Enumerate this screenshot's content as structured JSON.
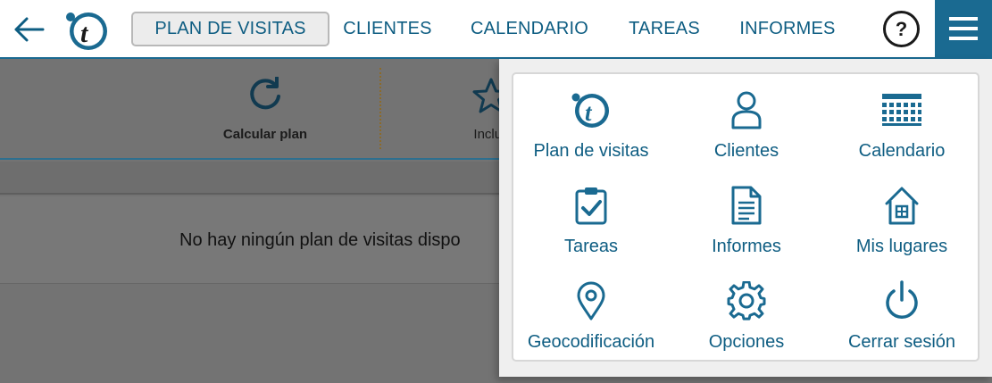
{
  "header": {
    "nav": [
      {
        "label": "PLAN DE VISITAS",
        "active": true
      },
      {
        "label": "CLIENTES",
        "active": false
      },
      {
        "label": "CALENDARIO",
        "active": false
      },
      {
        "label": "TAREAS",
        "active": false
      },
      {
        "label": "INFORMES",
        "active": false
      }
    ],
    "help_label": "?",
    "icons": {
      "back": "arrow-left-icon",
      "logo": "t-logo",
      "menu": "hamburger-icon"
    }
  },
  "toolbar": {
    "calculate_label": "Calcular plan",
    "include_label": "Inclus",
    "icons": {
      "calculate": "refresh-icon",
      "include": "star-icon"
    }
  },
  "main": {
    "empty_message": "No hay ningún plan de visitas dispo"
  },
  "menu": {
    "items": [
      {
        "label": "Plan de visitas",
        "icon": "t-logo"
      },
      {
        "label": "Clientes",
        "icon": "person-icon"
      },
      {
        "label": "Calendario",
        "icon": "calendar-icon"
      },
      {
        "label": "Tareas",
        "icon": "clipboard-check-icon"
      },
      {
        "label": "Informes",
        "icon": "document-icon"
      },
      {
        "label": "Mis lugares",
        "icon": "house-icon"
      },
      {
        "label": "Geocodificación",
        "icon": "map-pin-icon"
      },
      {
        "label": "Opciones",
        "icon": "gear-icon"
      },
      {
        "label": "Cerrar sesión",
        "icon": "power-icon"
      }
    ]
  },
  "colors": {
    "primary": "#1a6a91",
    "text": "#0e5d82",
    "overlay": "#737373"
  }
}
